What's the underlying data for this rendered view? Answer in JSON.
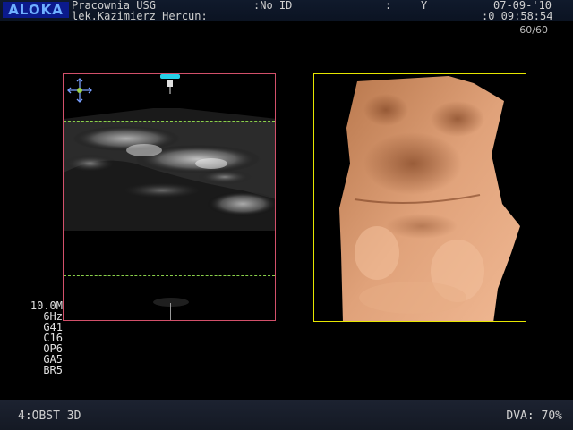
{
  "brand": "ALOKA",
  "header": {
    "institution": "Pracownia USG",
    "operator": "lek.Kazimierz Hercun:",
    "patient_id_label": ":No ID",
    "colon": ":",
    "y_label": "Y",
    "date": "07-09-'10",
    "time": ":0 09:58:54",
    "frame_counter": "60/60"
  },
  "parameters": [
    "10.0M",
    "6Hz",
    "G41",
    "C16",
    "OP6",
    "GA5",
    "BR5"
  ],
  "footer": {
    "mode": "4:OBST 3D",
    "dva": "DVA: 70%"
  },
  "colors": {
    "panel_2d_border": "#d2506a",
    "panel_3d_border": "#e6e600",
    "guide_line": "#8ad04a",
    "rendering_tone": "#d99a6c"
  },
  "icons": [
    "move-cursor-icon",
    "probe-marker-icon"
  ]
}
